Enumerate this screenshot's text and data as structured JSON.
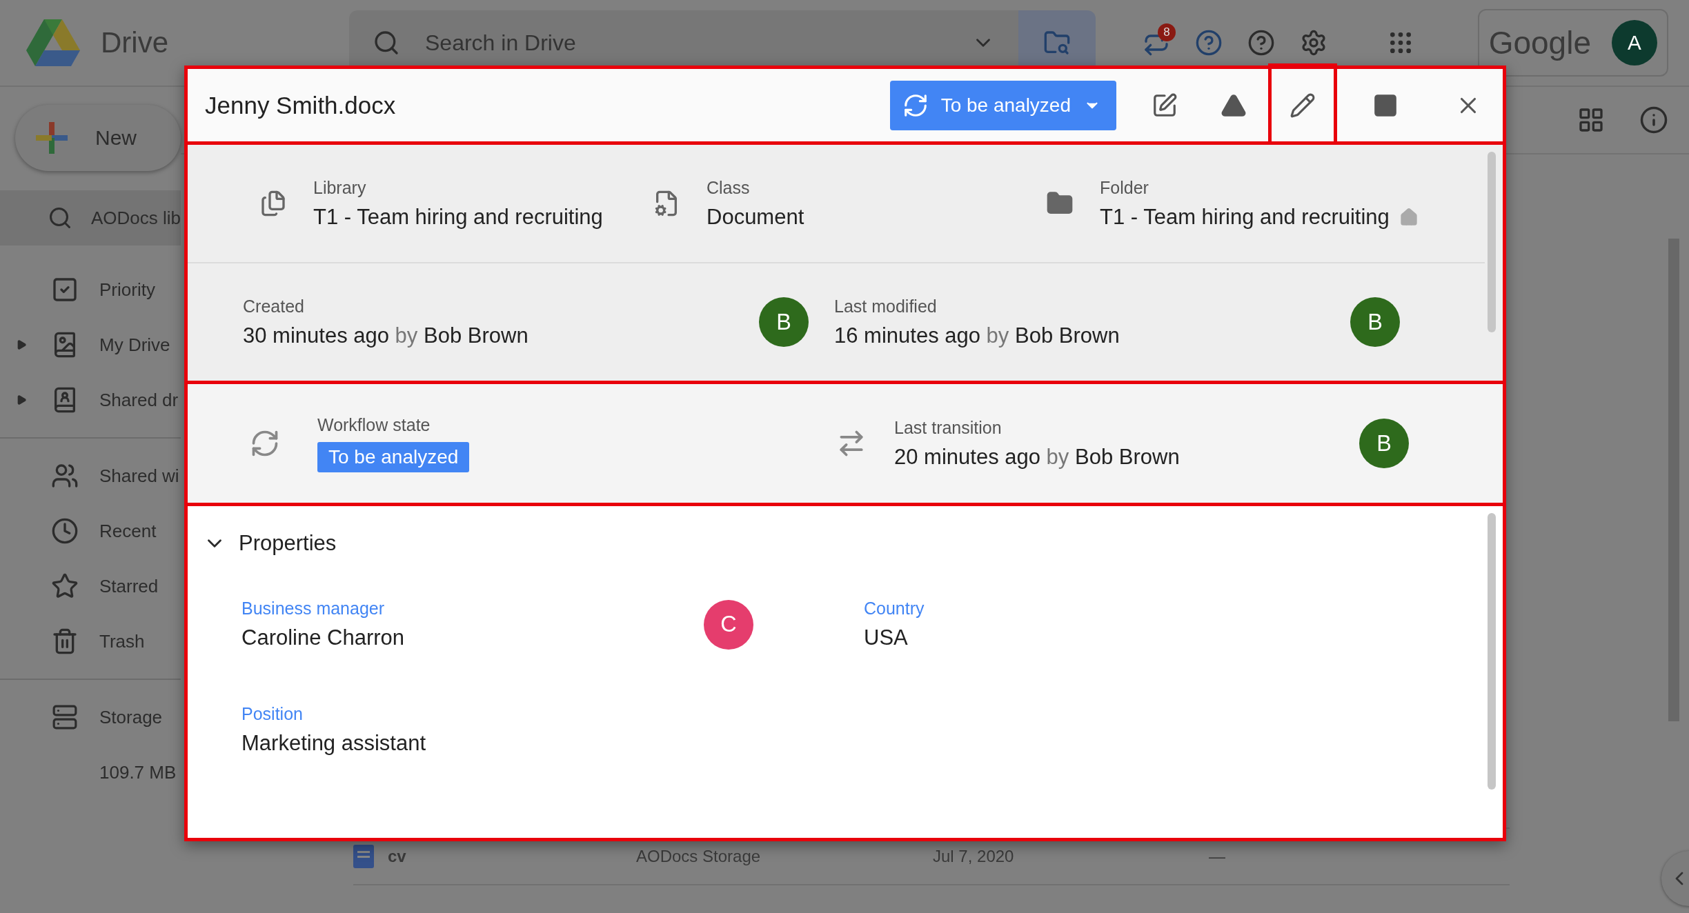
{
  "app": {
    "name": "Drive"
  },
  "search": {
    "placeholder": "Search in Drive"
  },
  "topbar": {
    "notification_count": "8",
    "brand": "Google",
    "avatar": "A"
  },
  "sidebar": {
    "new_button": "New",
    "search_item": "AODocs lib",
    "groups": [
      [
        {
          "label": "Priority",
          "expandable": false
        },
        {
          "label": "My Drive",
          "expandable": true
        },
        {
          "label": "Shared dr",
          "expandable": true
        }
      ],
      [
        {
          "label": "Shared wi",
          "expandable": false
        },
        {
          "label": "Recent",
          "expandable": false
        },
        {
          "label": "Starred",
          "expandable": false
        },
        {
          "label": "Trash",
          "expandable": false
        }
      ]
    ],
    "storage": {
      "label": "Storage",
      "used": "109.7 MB"
    }
  },
  "file_rows": [
    {
      "name": "cv",
      "location": "AODocs Storage",
      "modified": "Jul 7, 2020",
      "size": "—"
    }
  ],
  "dialog": {
    "title": "Jenny Smith.docx",
    "state_button": "To be analyzed",
    "actions": [
      {
        "kind": "sign",
        "highlighted": false
      },
      {
        "kind": "drive",
        "highlighted": false
      },
      {
        "kind": "edit",
        "highlighted": true
      },
      {
        "kind": "maximize",
        "highlighted": false
      },
      {
        "kind": "close",
        "highlighted": false
      }
    ],
    "location": [
      {
        "kind": "library",
        "label": "Library",
        "value": "T1 - Team hiring and recruiting",
        "home": false
      },
      {
        "kind": "class",
        "label": "Class",
        "value": "Document",
        "home": false
      },
      {
        "kind": "folder",
        "label": "Folder",
        "value": "T1 - Team hiring and recruiting",
        "home": true
      }
    ],
    "history": [
      {
        "label": "Created",
        "time": "30 minutes ago",
        "by": "by",
        "user": "Bob Brown",
        "avatar": "B",
        "color": "#2e6a1c"
      },
      {
        "label": "Last modified",
        "time": "16 minutes ago",
        "by": "by",
        "user": "Bob Brown",
        "avatar": "B",
        "color": "#2e6a1c"
      }
    ],
    "workflow": {
      "label": "Workflow state",
      "state": "To be analyzed",
      "transition_label": "Last transition",
      "time": "20 minutes ago",
      "by": "by",
      "user": "Bob Brown",
      "avatar": "B",
      "color": "#2e6a1c"
    },
    "properties": {
      "title": "Properties",
      "expanded": true,
      "fields": [
        {
          "label": "Business manager",
          "value": "Caroline Charron",
          "avatar": "C",
          "color": "#e53d6d"
        },
        {
          "label": "Country",
          "value": "USA"
        },
        {
          "label": "Position",
          "value": "Marketing assistant"
        }
      ]
    }
  }
}
